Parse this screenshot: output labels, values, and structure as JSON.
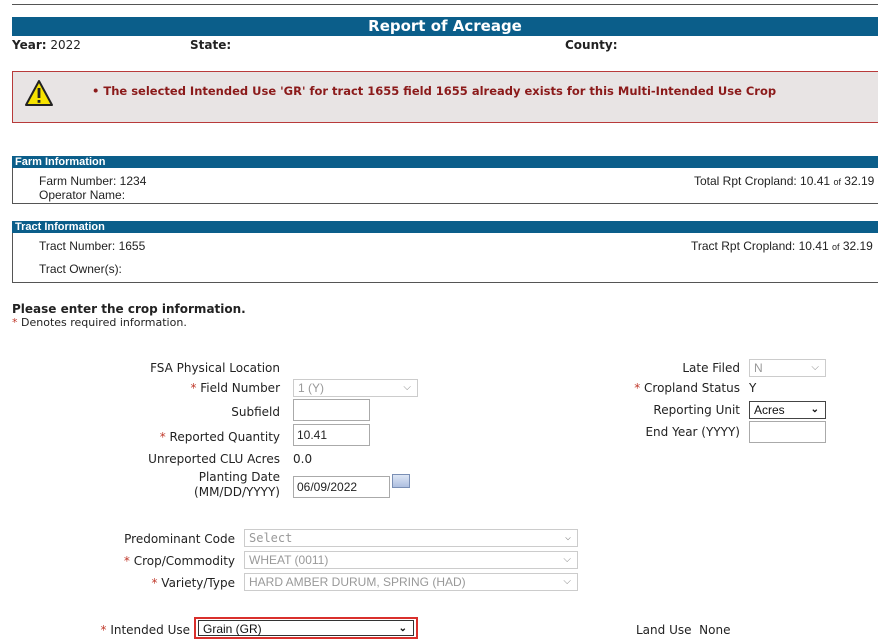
{
  "page": {
    "title": "Report of Acreage"
  },
  "header": {
    "year_label": "Year:",
    "year_value": "2022",
    "state_label": "State:",
    "county_label": "County:"
  },
  "error": {
    "message": "• The selected Intended Use 'GR' for tract 1655 field 1655 already exists for this Multi-Intended Use Crop"
  },
  "farm": {
    "title": "Farm Information",
    "farm_number": "Farm Number: 1234",
    "operator": "Operator Name:",
    "cropland_label": "Total Rpt Cropland: 10.41",
    "cropland_of": "of",
    "cropland_total": "32.19"
  },
  "tract": {
    "title": "Tract Information",
    "tract_number": "Tract Number: 1655",
    "owner": "Tract Owner(s):",
    "cropland_label": "Tract Rpt Cropland: 10.41",
    "cropland_of": "of",
    "cropland_total": "32.19"
  },
  "instructions": {
    "heading": "Please enter the crop information.",
    "required_mark": "*",
    "required_note": "Denotes required information."
  },
  "form": {
    "physical_location_label": "FSA Physical Location",
    "field_number_label": "Field Number",
    "field_number_value": "1 (Y)",
    "subfield_label": "Subfield",
    "subfield_value": "",
    "reported_quantity_label": "Reported Quantity",
    "reported_quantity_value": "10.41",
    "unreported_clu_label": "Unreported CLU Acres",
    "unreported_clu_value": "0.0",
    "planting_date_label_1": "Planting Date",
    "planting_date_label_2": "(MM/DD/YYYY)",
    "planting_date_value": "06/09/2022",
    "late_filed_label": "Late Filed",
    "late_filed_value": "N",
    "cropland_status_label": "Cropland Status",
    "cropland_status_value": "Y",
    "reporting_unit_label": "Reporting Unit",
    "reporting_unit_value": "Acres",
    "end_year_label": "End Year (YYYY)",
    "end_year_value": "",
    "predominant_code_label": "Predominant Code",
    "predominant_code_value": "Select",
    "crop_label": "Crop/Commodity",
    "crop_value": "WHEAT (0011)",
    "variety_label": "Variety/Type",
    "variety_value": "HARD AMBER DURUM, SPRING (HAD)",
    "intended_use_label": "Intended Use",
    "intended_use_value": "Grain (GR)",
    "land_use_label": "Land Use",
    "land_use_value": "None"
  },
  "colors": {
    "header_bar": "#0b5e8a",
    "error_text": "#8b1a1a",
    "required": "#c0392b",
    "highlight": "#d9302c"
  }
}
